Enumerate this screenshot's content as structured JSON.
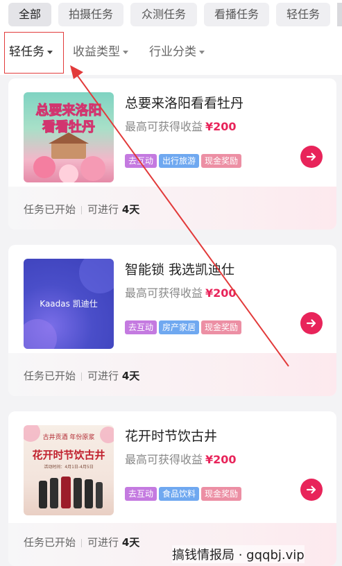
{
  "tabs": [
    {
      "label": "全部"
    },
    {
      "label": "拍摄任务"
    },
    {
      "label": "众测任务"
    },
    {
      "label": "看播任务"
    },
    {
      "label": "轻任务"
    }
  ],
  "filters": [
    {
      "label": "轻任务"
    },
    {
      "label": "收益类型"
    },
    {
      "label": "行业分类"
    }
  ],
  "tasks": [
    {
      "title": "总要来洛阳看看牡丹",
      "earn_label": "最高可获得收益",
      "amount": "¥200",
      "tags": [
        "去互动",
        "出行旅游",
        "现金奖励"
      ],
      "status": "任务已开始",
      "duration_label": "可进行",
      "days": "4天",
      "thumb_text_1": "总要来洛阳",
      "thumb_text_2": "看看牡丹"
    },
    {
      "title": "智能锁 我选凯迪仕",
      "earn_label": "最高可获得收益",
      "amount": "¥200",
      "tags": [
        "去互动",
        "房产家居",
        "现金奖励"
      ],
      "status": "任务已开始",
      "duration_label": "可进行",
      "days": "4天",
      "thumb_text_1": "Kaadas 凯迪仕"
    },
    {
      "title": "花开时节饮古井",
      "earn_label": "最高可获得收益",
      "amount": "¥200",
      "tags": [
        "去互动",
        "食品饮料",
        "现金奖励"
      ],
      "status": "任务已开始",
      "duration_label": "可进行",
      "days": "4天",
      "thumb_text_1": "古井贡酒 年份原浆",
      "thumb_text_2": "花开时节饮古井",
      "thumb_text_3": "活动时间：4月1日-4月5日"
    }
  ],
  "watermark": "搞钱情报局 · gqqbj.vip",
  "colors": {
    "accent": "#e8245a",
    "annotation": "#e23a3a"
  },
  "icons": {
    "go": "arrow-right-icon",
    "caret": "caret-down-icon"
  }
}
